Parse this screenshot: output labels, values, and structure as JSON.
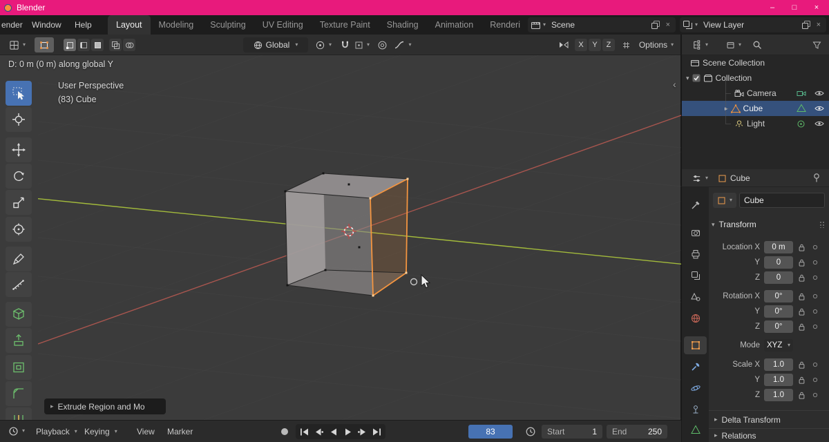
{
  "glyphs": {
    "dropdown": "▾",
    "disclosure_open": "▾",
    "disclosure_closed": "▸",
    "close": "×",
    "minimize": "–",
    "maximize": "□",
    "sidebar_toggle": "‹"
  },
  "titlebar": {
    "app_name": "Blender"
  },
  "menubar": {
    "menus": [
      {
        "label": "ender"
      },
      {
        "label": "Window"
      },
      {
        "label": "Help"
      }
    ],
    "tabs": [
      {
        "label": "Layout"
      },
      {
        "label": "Modeling"
      },
      {
        "label": "Sculpting"
      },
      {
        "label": "UV Editing"
      },
      {
        "label": "Texture Paint"
      },
      {
        "label": "Shading"
      },
      {
        "label": "Animation"
      },
      {
        "label": "Renderi"
      }
    ],
    "scene_selector": {
      "value": "Scene"
    },
    "view_layer_selector": {
      "value": "View Layer"
    }
  },
  "tool_header": {
    "orientation_value": "Global",
    "mirror_axes": [
      "X",
      "Y",
      "Z"
    ],
    "options_label": "Options"
  },
  "viewport": {
    "drag_status": "D: 0 m (0 m) along global Y",
    "view_label": "User Perspective",
    "object_label": "(83) Cube",
    "operator_label": "Extrude Region and Mo"
  },
  "outliner": {
    "rows": [
      {
        "label": "Scene Collection"
      },
      {
        "label": "Collection"
      },
      {
        "label": "Camera"
      },
      {
        "label": "Cube"
      },
      {
        "label": "Light"
      }
    ]
  },
  "properties": {
    "breadcrumb_object": "Cube",
    "object_name": "Cube",
    "transform_title": "Transform",
    "rows": [
      {
        "label": "Location X",
        "value": "0 m"
      },
      {
        "label": "Y",
        "value": "0"
      },
      {
        "label": "Z",
        "value": "0"
      },
      {
        "label": "Rotation X",
        "value": "0°"
      },
      {
        "label": "Y",
        "value": "0°"
      },
      {
        "label": "Z",
        "value": "0°"
      },
      {
        "label": "Mode",
        "value": "XYZ"
      },
      {
        "label": "Scale X",
        "value": "1.0"
      },
      {
        "label": "Y",
        "value": "1.0"
      },
      {
        "label": "Z",
        "value": "1.0"
      }
    ],
    "collapsed": [
      {
        "label": "Delta Transform"
      },
      {
        "label": "Relations"
      }
    ]
  },
  "timeline": {
    "menus": [
      {
        "label": "Playback"
      },
      {
        "label": "Keying"
      },
      {
        "label": "View"
      },
      {
        "label": "Marker"
      }
    ],
    "current_frame": "83",
    "start_label": "Start",
    "start_value": "1",
    "end_label": "End",
    "end_value": "250"
  }
}
